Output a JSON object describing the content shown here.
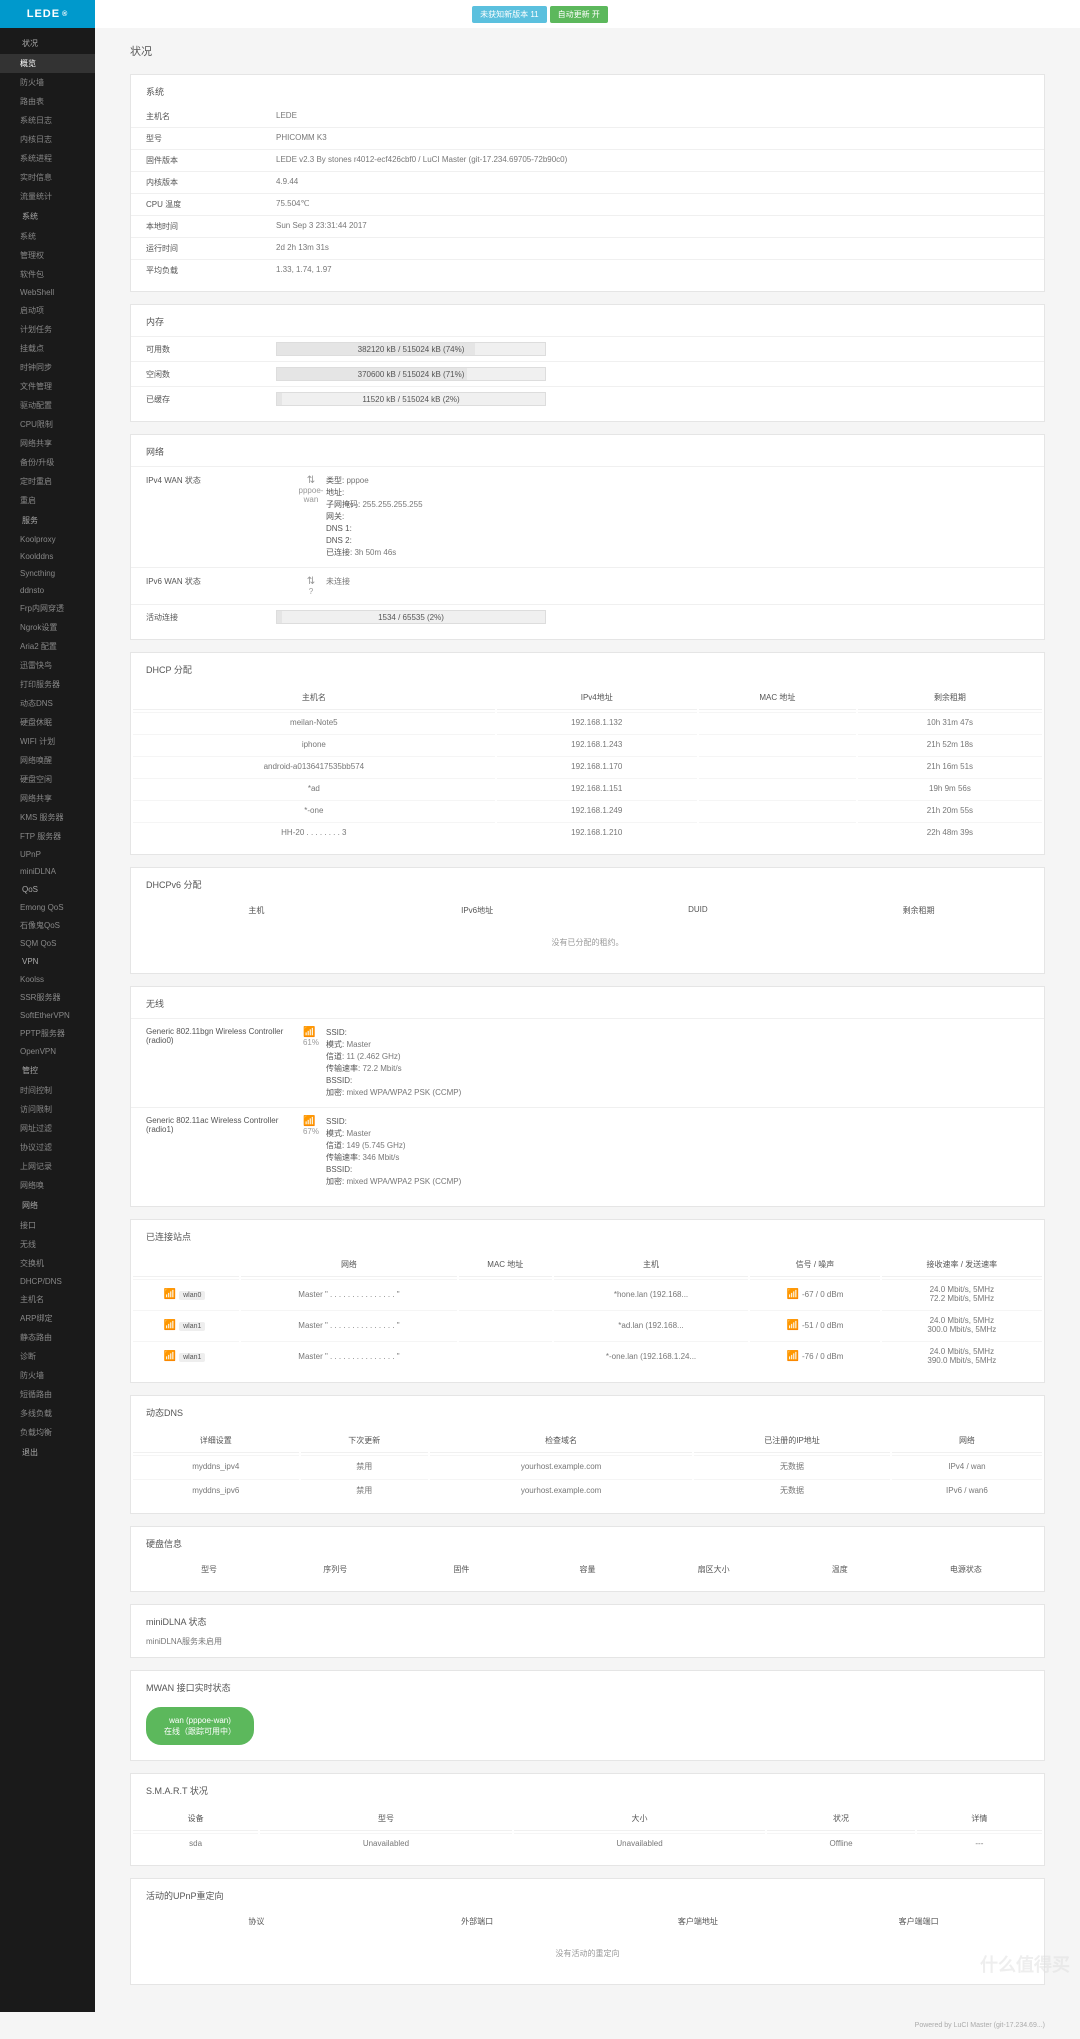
{
  "brand": "LEDE",
  "topBadges": [
    {
      "cls": "blue",
      "text": "未获知新版本 11"
    },
    {
      "cls": "green",
      "text": "自动更新 开"
    }
  ],
  "pageTitle": "状况",
  "sidebar": [
    {
      "cat": "状况",
      "icon": "i-home",
      "items": [
        "概览",
        "防火墙",
        "路由表",
        "系统日志",
        "内核日志",
        "系统进程",
        "实时信息",
        "流量统计"
      ],
      "active": 0
    },
    {
      "cat": "系统",
      "icon": "i-tool",
      "items": [
        "系统",
        "管理权",
        "软件包",
        "WebShell",
        "启动项",
        "计划任务",
        "挂载点",
        "时钟同步",
        "文件管理",
        "驱动配置",
        "CPU限制",
        "网络共享",
        "备份/升级",
        "定时重启",
        "重启"
      ]
    },
    {
      "cat": "服务",
      "icon": "i-svc",
      "items": [
        "Koolproxy",
        "Koolddns",
        "Syncthing",
        "ddnsto",
        "Frp内网穿透",
        "Ngrok设置",
        "Aria2 配置",
        "迅雷快鸟",
        "打印服务器",
        "动态DNS",
        "硬盘休眠",
        "WIFI 计划",
        "网络唤醒",
        "硬盘空闲",
        "网络共享",
        "KMS 服务器",
        "FTP 服务器",
        "UPnP",
        "miniDLNA"
      ]
    },
    {
      "cat": "QoS",
      "icon": "i-qos",
      "items": [
        "Emong QoS",
        "石像鬼QoS",
        "SQM QoS"
      ]
    },
    {
      "cat": "VPN",
      "icon": "i-vpn",
      "items": [
        "Koolss",
        "SSR服务器",
        "SoftEtherVPN",
        "PPTP服务器",
        "OpenVPN"
      ]
    },
    {
      "cat": "管控",
      "icon": "i-ctrl",
      "items": [
        "时间控制",
        "访问限制",
        "网址过滤",
        "协议过滤",
        "上网记录",
        "网络唤"
      ]
    },
    {
      "cat": "网络",
      "icon": "i-net",
      "items": [
        "接口",
        "无线",
        "交换机",
        "DHCP/DNS",
        "主机名",
        "ARP绑定",
        "静态路由",
        "诊断",
        "防火墙",
        "短循路由",
        "多线负载",
        "负载均衡"
      ]
    },
    {
      "cat": "退出",
      "icon": "i-exit",
      "items": []
    }
  ],
  "system": {
    "title": "系统",
    "rows": [
      {
        "k": "主机名",
        "v": "LEDE"
      },
      {
        "k": "型号",
        "v": "PHICOMM K3"
      },
      {
        "k": "固件版本",
        "v": "LEDE v2.3 By stones r4012-ecf426cbf0 / LuCI Master (git-17.234.69705-72b90c0)"
      },
      {
        "k": "内核版本",
        "v": "4.9.44"
      },
      {
        "k": "CPU 温度",
        "v": "75.504℃"
      },
      {
        "k": "本地时间",
        "v": "Sun Sep 3 23:31:44 2017"
      },
      {
        "k": "运行时间",
        "v": "2d 2h 13m 31s"
      },
      {
        "k": "平均负载",
        "v": "1.33, 1.74, 1.97"
      }
    ]
  },
  "memory": {
    "title": "内存",
    "rows": [
      {
        "k": "可用数",
        "text": "382120 kB / 515024 kB (74%)",
        "pct": 74
      },
      {
        "k": "空闲数",
        "text": "370600 kB / 515024 kB (71%)",
        "pct": 71
      },
      {
        "k": "已缓存",
        "text": "11520 kB / 515024 kB (2%)",
        "pct": 2
      }
    ]
  },
  "network": {
    "title": "网络",
    "ipv4": {
      "label": "IPv4 WAN 状态",
      "iface": "pppoe-wan",
      "lines": [
        {
          "k": "类型:",
          "v": "pppoe"
        },
        {
          "k": "地址:",
          "v": ""
        },
        {
          "k": "子网掩码:",
          "v": "255.255.255.255"
        },
        {
          "k": "网关:",
          "v": ""
        },
        {
          "k": "DNS 1:",
          "v": ""
        },
        {
          "k": "DNS 2:",
          "v": ""
        },
        {
          "k": "已连接:",
          "v": "3h 50m 46s"
        }
      ]
    },
    "ipv6": {
      "label": "IPv6 WAN 状态",
      "iface": "?",
      "text": "未连接"
    },
    "conn": {
      "label": "活动连接",
      "text": "1534 / 65535 (2%)",
      "pct": 2
    }
  },
  "dhcp": {
    "title": "DHCP 分配",
    "headers": [
      "主机名",
      "IPv4地址",
      "MAC 地址",
      "剩余租期"
    ],
    "rows": [
      [
        "meilan-Note5",
        "192.168.1.132",
        "",
        "10h 31m 47s"
      ],
      [
        "iphone",
        "192.168.1.243",
        "",
        "21h 52m 18s"
      ],
      [
        "android-a0136417535bb574",
        "192.168.1.170",
        "",
        "21h 16m 51s"
      ],
      [
        "*ad",
        "192.168.1.151",
        "",
        "19h 9m 56s"
      ],
      [
        "*-one",
        "192.168.1.249",
        "",
        "21h 20m 55s"
      ],
      [
        "HH-20 . . . . . . . . 3",
        "192.168.1.210",
        "",
        "22h 48m 39s"
      ]
    ]
  },
  "dhcpv6": {
    "title": "DHCPv6 分配",
    "headers": [
      "主机",
      "IPv6地址",
      "DUID",
      "剩余租期"
    ],
    "empty": "没有已分配的租约。"
  },
  "wireless": {
    "title": "无线",
    "radios": [
      {
        "name": "Generic 802.11bgn Wireless Controller (radio0)",
        "pct": "61%",
        "lines": [
          {
            "k": "SSID:",
            "v": ""
          },
          {
            "k": "模式:",
            "v": "Master"
          },
          {
            "k": "信道:",
            "v": "11 (2.462 GHz)"
          },
          {
            "k": "传输速率:",
            "v": "72.2 Mbit/s"
          },
          {
            "k": "BSSID:",
            "v": ""
          },
          {
            "k": "加密:",
            "v": "mixed WPA/WPA2 PSK (CCMP)"
          }
        ]
      },
      {
        "name": "Generic 802.11ac Wireless Controller (radio1)",
        "pct": "67%",
        "lines": [
          {
            "k": "SSID:",
            "v": ""
          },
          {
            "k": "模式:",
            "v": "Master"
          },
          {
            "k": "信道:",
            "v": "149 (5.745 GHz)"
          },
          {
            "k": "传输速率:",
            "v": "346 Mbit/s"
          },
          {
            "k": "BSSID:",
            "v": ""
          },
          {
            "k": "加密:",
            "v": "mixed WPA/WPA2 PSK (CCMP)"
          }
        ]
      }
    ]
  },
  "assoc": {
    "title": "已连接站点",
    "headers": [
      "网络",
      "MAC 地址",
      "主机",
      "信号 / 噪声",
      "接收速率 / 发送速率"
    ],
    "rows": [
      {
        "if": "wlan0",
        "net": "Master \" . . . . . . . . . . . . . . . \"",
        "host": "*hone.lan (192.168...",
        "sig": "-67 / 0 dBm",
        "rate": "24.0 Mbit/s, 5MHz\n72.2 Mbit/s, 5MHz"
      },
      {
        "if": "wlan1",
        "net": "Master \" . . . . . . . . . . . . . . . \"",
        "host": "*ad.lan (192.168...",
        "sig": "-51 / 0 dBm",
        "rate": "24.0 Mbit/s, 5MHz\n300.0 Mbit/s, 5MHz"
      },
      {
        "if": "wlan1",
        "net": "Master \" . . . . . . . . . . . . . . . \"",
        "host": "*-one.lan (192.168.1.24...",
        "sig": "-76 / 0 dBm",
        "rate": "24.0 Mbit/s, 5MHz\n390.0 Mbit/s, 5MHz"
      }
    ]
  },
  "ddns": {
    "title": "动态DNS",
    "headers": [
      "详细设置",
      "下次更新",
      "检查域名",
      "已注册的IP地址",
      "网络"
    ],
    "rows": [
      [
        "myddns_ipv4",
        "禁用",
        "yourhost.example.com",
        "无数据",
        "IPv4 / wan"
      ],
      [
        "myddns_ipv6",
        "禁用",
        "yourhost.example.com",
        "无数据",
        "IPv6 / wan6"
      ]
    ]
  },
  "disk": {
    "title": "硬盘信息",
    "headers": [
      "型号",
      "序列号",
      "固件",
      "容量",
      "扇区大小",
      "温度",
      "电源状态"
    ]
  },
  "minidlna": {
    "title": "miniDLNA 状态",
    "msg": "miniDLNA服务未启用"
  },
  "mwan": {
    "title": "MWAN 接口实时状态",
    "badge": "wan (pppoe-wan)\n在线（跟踪可用中）"
  },
  "smart": {
    "title": "S.M.A.R.T 状况",
    "headers": [
      "设备",
      "型号",
      "大小",
      "状况",
      "详情"
    ],
    "rows": [
      [
        "sda",
        "Unavailabled",
        "Unavailabled",
        "Offline",
        "---"
      ]
    ]
  },
  "upnp": {
    "title": "活动的UPnP重定向",
    "headers": [
      "协议",
      "外部端口",
      "客户端地址",
      "客户端端口"
    ],
    "empty": "没有活动的重定向"
  },
  "footer": "Powered by LuCI Master (git-17.234.69...)",
  "watermark": "什么值得买"
}
